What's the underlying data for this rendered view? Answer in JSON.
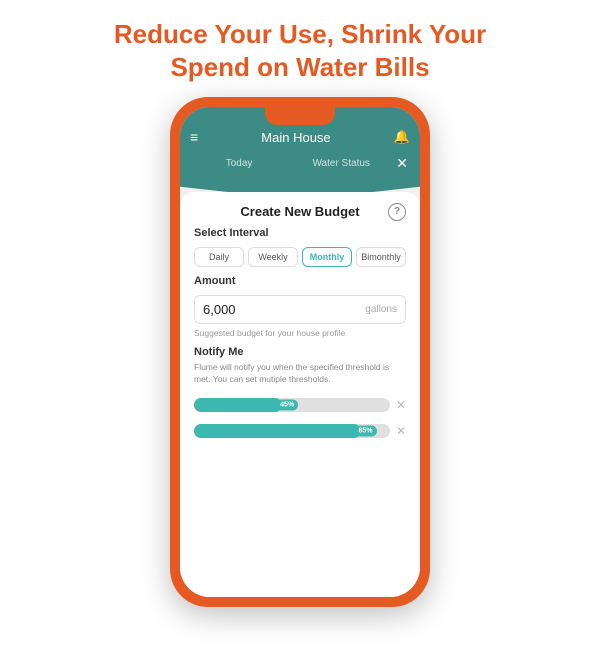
{
  "page": {
    "header_line1": "Reduce Your Use, Shrink Your",
    "header_line2": "Spend on Water Bills"
  },
  "phone": {
    "nav": {
      "title": "Main House",
      "menu_icon": "≡",
      "bell_icon": "🔔"
    },
    "tabs": [
      {
        "label": "Today"
      },
      {
        "label": "Water Status"
      }
    ],
    "modal": {
      "title": "Create New Budget",
      "help_icon": "?",
      "select_interval_label": "Select Interval",
      "intervals": [
        {
          "label": "Daily",
          "active": false
        },
        {
          "label": "Weekly",
          "active": false
        },
        {
          "label": "Monthly",
          "active": true
        },
        {
          "label": "Bimonthly",
          "active": false
        }
      ],
      "amount_label": "Amount",
      "amount_value": "6,000",
      "amount_unit": "gallons",
      "suggestion_text": "Suggested budget for your house profile",
      "notify_title": "Notify Me",
      "notify_desc": "Flume will notify you when the specified threshold is met. You can set mutiple thresholds.",
      "sliders": [
        {
          "percent": 45,
          "fill_pct": 45
        },
        {
          "percent": 85,
          "fill_pct": 85
        }
      ]
    }
  }
}
